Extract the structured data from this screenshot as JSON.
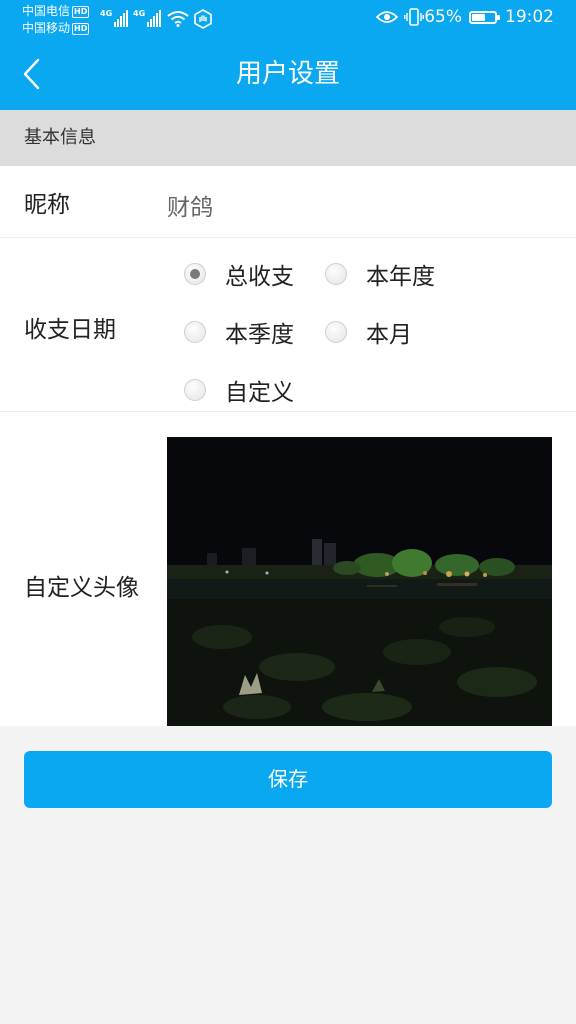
{
  "status_bar": {
    "carrier_1": "中国电信",
    "carrier_2": "中国移动",
    "hd_badge": "HD",
    "network_type": "4G",
    "battery": "65%",
    "battery_level": 0.65,
    "time": "19:02",
    "icons": [
      "signal-icon",
      "wifi-icon",
      "eye-comfort-icon",
      "vibrate-icon",
      "battery-icon"
    ]
  },
  "header": {
    "title": "用户设置",
    "back_icon": "chevron-left-icon"
  },
  "section": {
    "title": "基本信息"
  },
  "form": {
    "nickname_label": "昵称",
    "nickname_value": "财鸽",
    "date_label": "收支日期",
    "date_options": [
      {
        "label": "总收支",
        "checked": true
      },
      {
        "label": "本年度",
        "checked": false
      },
      {
        "label": "本季度",
        "checked": false
      },
      {
        "label": "本月",
        "checked": false
      },
      {
        "label": "自定义",
        "checked": false
      }
    ],
    "avatar_label": "自定义头像"
  },
  "actions": {
    "save_label": "保存"
  },
  "colors": {
    "primary": "#0aa8f1",
    "section_bg": "#dcdcdc",
    "page_bg": "#f3f3f3"
  }
}
